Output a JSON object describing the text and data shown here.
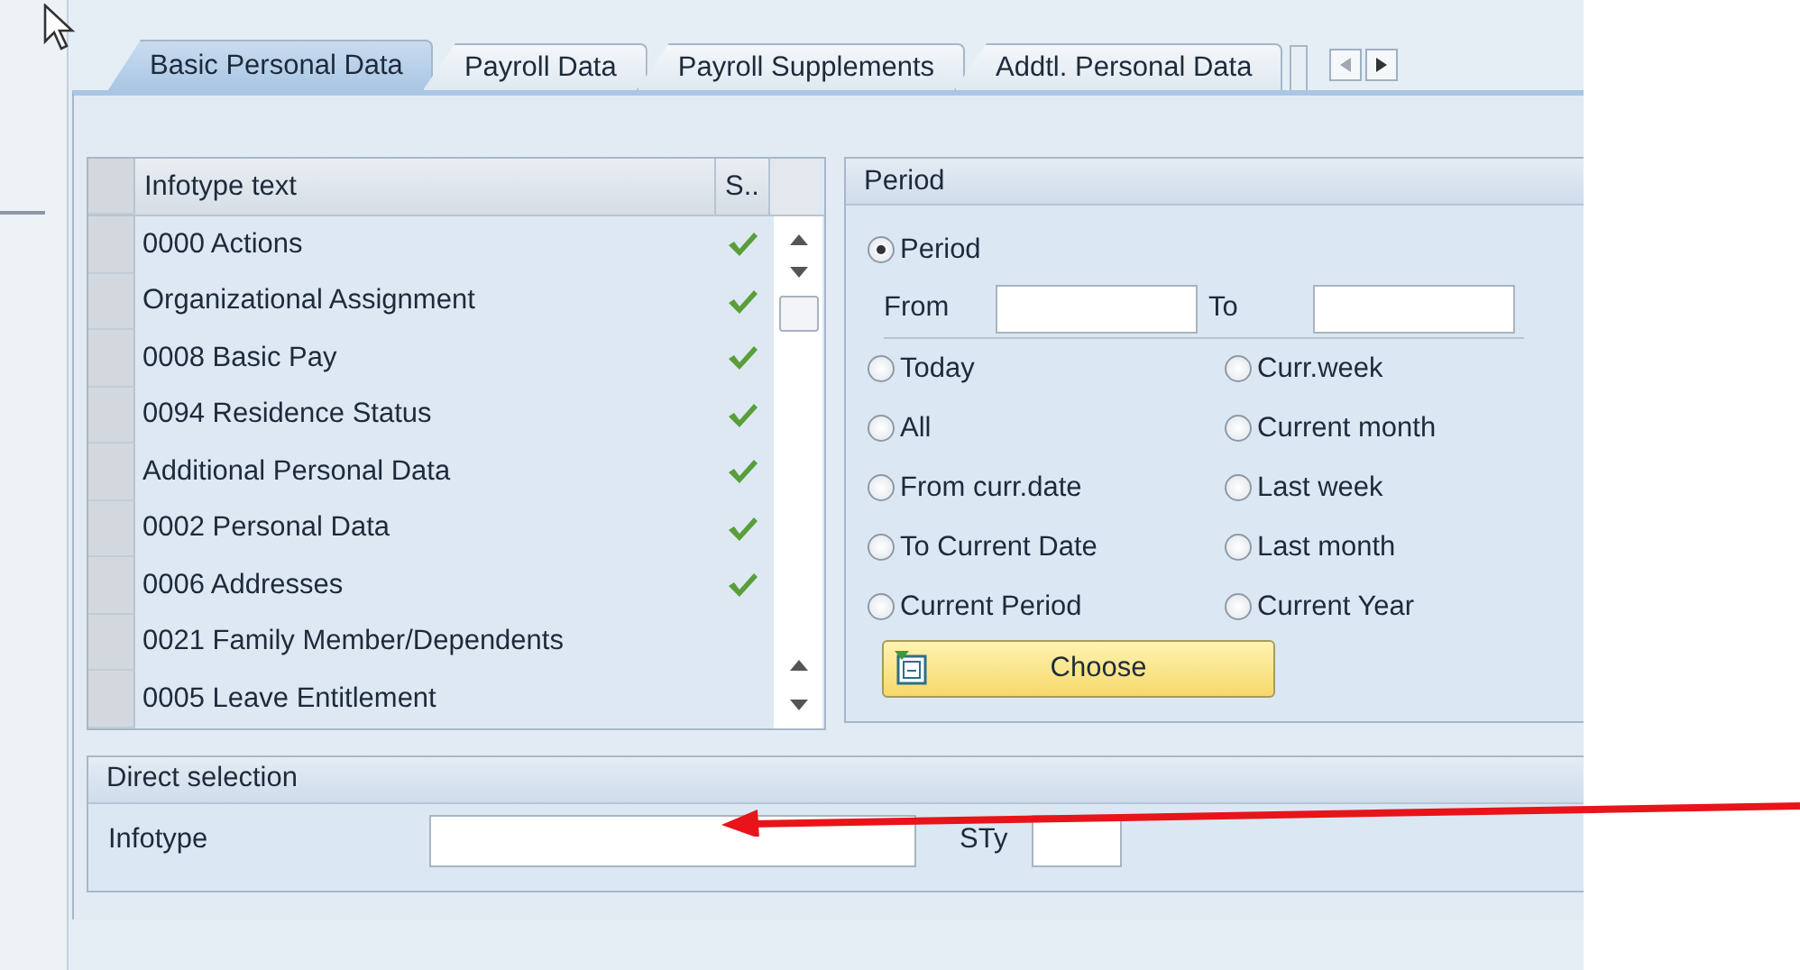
{
  "tabs": [
    {
      "label": "Basic Personal Data",
      "selected": true
    },
    {
      "label": "Payroll Data",
      "selected": false
    },
    {
      "label": "Payroll Supplements",
      "selected": false
    },
    {
      "label": "Addtl. Personal Data",
      "selected": false
    }
  ],
  "infotype_table": {
    "columns": [
      "Infotype text",
      "S.."
    ],
    "rows": [
      {
        "text": "0000 Actions",
        "has_data": true
      },
      {
        "text": "Organizational Assignment",
        "has_data": true
      },
      {
        "text": "0008 Basic Pay",
        "has_data": true
      },
      {
        "text": "0094 Residence Status",
        "has_data": true
      },
      {
        "text": "Additional Personal Data",
        "has_data": true
      },
      {
        "text": "0002 Personal Data",
        "has_data": true
      },
      {
        "text": "0006 Addresses",
        "has_data": true
      },
      {
        "text": "0021 Family Member/Dependents",
        "has_data": false
      },
      {
        "text": "0005 Leave Entitlement",
        "has_data": false
      }
    ]
  },
  "period": {
    "title": "Period",
    "main_option": {
      "label": "Period",
      "selected": true
    },
    "from_label": "From",
    "to_label": "To",
    "options": [
      {
        "label": "Today",
        "selected": false
      },
      {
        "label": "Curr.week",
        "selected": false
      },
      {
        "label": "All",
        "selected": false
      },
      {
        "label": "Current month",
        "selected": false
      },
      {
        "label": "From curr.date",
        "selected": false
      },
      {
        "label": "Last week",
        "selected": false
      },
      {
        "label": "To Current Date",
        "selected": false
      },
      {
        "label": "Last month",
        "selected": false
      },
      {
        "label": "Current Period",
        "selected": false
      },
      {
        "label": "Current Year",
        "selected": false
      }
    ],
    "button": "Choose"
  },
  "direct_selection": {
    "title": "Direct selection",
    "infotype_label": "Infotype",
    "subtype_label": "STy"
  }
}
